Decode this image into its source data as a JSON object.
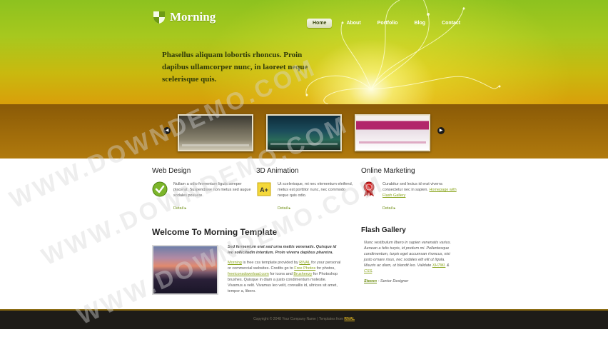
{
  "header": {
    "logo_text": "Morning",
    "nav": [
      {
        "label": "Home",
        "active": true
      },
      {
        "label": "About",
        "active": false
      },
      {
        "label": "Portfolio",
        "active": false
      },
      {
        "label": "Blog",
        "active": false
      },
      {
        "label": "Contact",
        "active": false
      }
    ],
    "tagline": "Phasellus aliquam lobortis rhoncus. Proin dapibus ullamcorper nunc, in laoreet neque scelerisque quis."
  },
  "slider": {
    "prev_glyph": "◀",
    "next_glyph": "▶"
  },
  "features": [
    {
      "title": "Web Design",
      "icon": "checkmark-icon",
      "text": "Nullam a odio fermentum ligula semper placerat. Suspendisse non metus sed augue sodales posuere.",
      "link": "Detail"
    },
    {
      "title": "3D Animation",
      "icon": "a-plus-note-icon",
      "text": "Ut scelerisque, mi nec elementum eleifend, metus est porttitor nunc, nec commodo neque quis odio.",
      "link": "Detail"
    },
    {
      "title": "Online Marketing",
      "icon": "award-ribbon-icon",
      "text_before": "Curabitur sed lectus id erat viverra consectetur nec in sapien. ",
      "text_link": "Homepage with Flash Gallery",
      "link": "Detail"
    }
  ],
  "welcome": {
    "title": "Welcome To Morning Template",
    "lead": "Sed fermentum erat sed urna mattis venenatis. Quisque id leo sollicitudin interdum. Proin viverra dapibus pharetra.",
    "body_parts": [
      {
        "text": "Morning",
        "link": true
      },
      {
        "text": " is free css template provided by ",
        "link": false
      },
      {
        "text": "RIVAL",
        "link": true
      },
      {
        "text": " for your personal or commercial websites. Credits go to ",
        "link": false
      },
      {
        "text": "Free Photos",
        "link": true
      },
      {
        "text": " for photos, ",
        "link": false
      },
      {
        "text": "freeiconsdownload.com",
        "link": true
      },
      {
        "text": " for icons and ",
        "link": false
      },
      {
        "text": "Brusheezy",
        "link": true
      },
      {
        "text": " for Photoshop brushes. Quisque in diam a justo condimentum molestie. Vivamus a velit. Vivamus leo velit, convallis id, ultrices sit amet, tempor a, libero.",
        "link": false
      }
    ]
  },
  "flash_gallery": {
    "title": "Flash Gallery",
    "quote_parts": [
      {
        "text": "Nunc vestibulum libero in sapien venenatis varius. Aenean a felis turpis, id pretium mi. Pellentesque condimentum, turpis eget accumsan rhoncus, nisi justo ornare risus, nec sodales elit elit ut ligula. Mauris ac diam, ut blandit leo. Validate ",
        "link": false
      },
      {
        "text": "XHTML",
        "link": true
      },
      {
        "text": " & ",
        "link": false
      },
      {
        "text": "CSS",
        "link": true
      },
      {
        "text": ".",
        "link": false
      }
    ],
    "author_name": "Steven",
    "author_role": " - Senior Designer"
  },
  "footer": {
    "text": "Copyright © 2048 Your Company Name | Templates from ",
    "brand": "RIVAL"
  },
  "watermark": {
    "text": "WWW.DOWNDEMO.COM"
  },
  "colors": {
    "header_top": "#8dc21f",
    "header_bottom": "#d99f0a",
    "slider_band": "#a06c0a",
    "link_green": "#6f8f15",
    "footer_bg": "#1e1c18"
  }
}
